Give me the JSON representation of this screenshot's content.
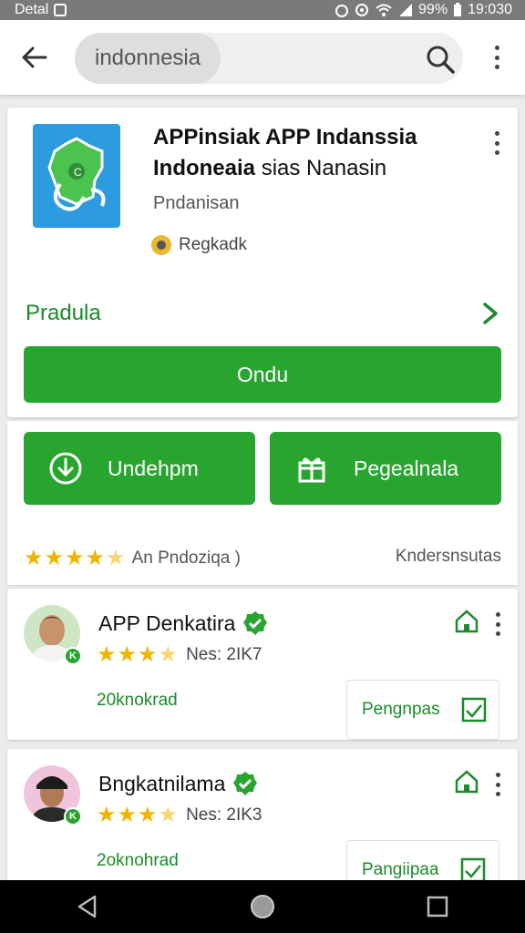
{
  "status_bar": {
    "carrier": "Detal",
    "battery": "99%",
    "time": "19:030"
  },
  "search": {
    "query": "indonnesia"
  },
  "app": {
    "title_line1": "APPinsiak APP Indanssia",
    "title_line2_bold": "Indoneaia",
    "title_line2_rest": "sias Nanasin",
    "developer": "Pndanisan",
    "tag": "Regkadk",
    "section_link": "Pradula",
    "primary_button": "Ondu"
  },
  "actions": {
    "left_button": "Undehpm",
    "right_button": "Pegealnala"
  },
  "rating": {
    "stars": 4.5,
    "summary": "An Pndoziqa )",
    "right_text": "Kndersnsutas"
  },
  "reviews": [
    {
      "name": "APP Denkatira",
      "rating_text": "Nes: 2IK7",
      "link": "20knokrad",
      "side_button": "Pengnpas",
      "stars": 3.5
    },
    {
      "name": "Bngkatnilama",
      "rating_text": "Nes: 2IK3",
      "link": "2oknohrad",
      "side_button": "Pangiipaa",
      "stars": 3.5
    }
  ],
  "colors": {
    "brand_green": "#27a52e",
    "link_green": "#1b8a2a",
    "star": "#f0b400",
    "app_icon_bg": "#2d9be0"
  },
  "icons": [
    "back-arrow-icon",
    "search-icon",
    "more-vert-icon",
    "download-icon",
    "gift-icon",
    "verified-icon",
    "home-icon",
    "calendar-icon",
    "nav-back-icon",
    "nav-home-icon",
    "nav-recents-icon"
  ]
}
